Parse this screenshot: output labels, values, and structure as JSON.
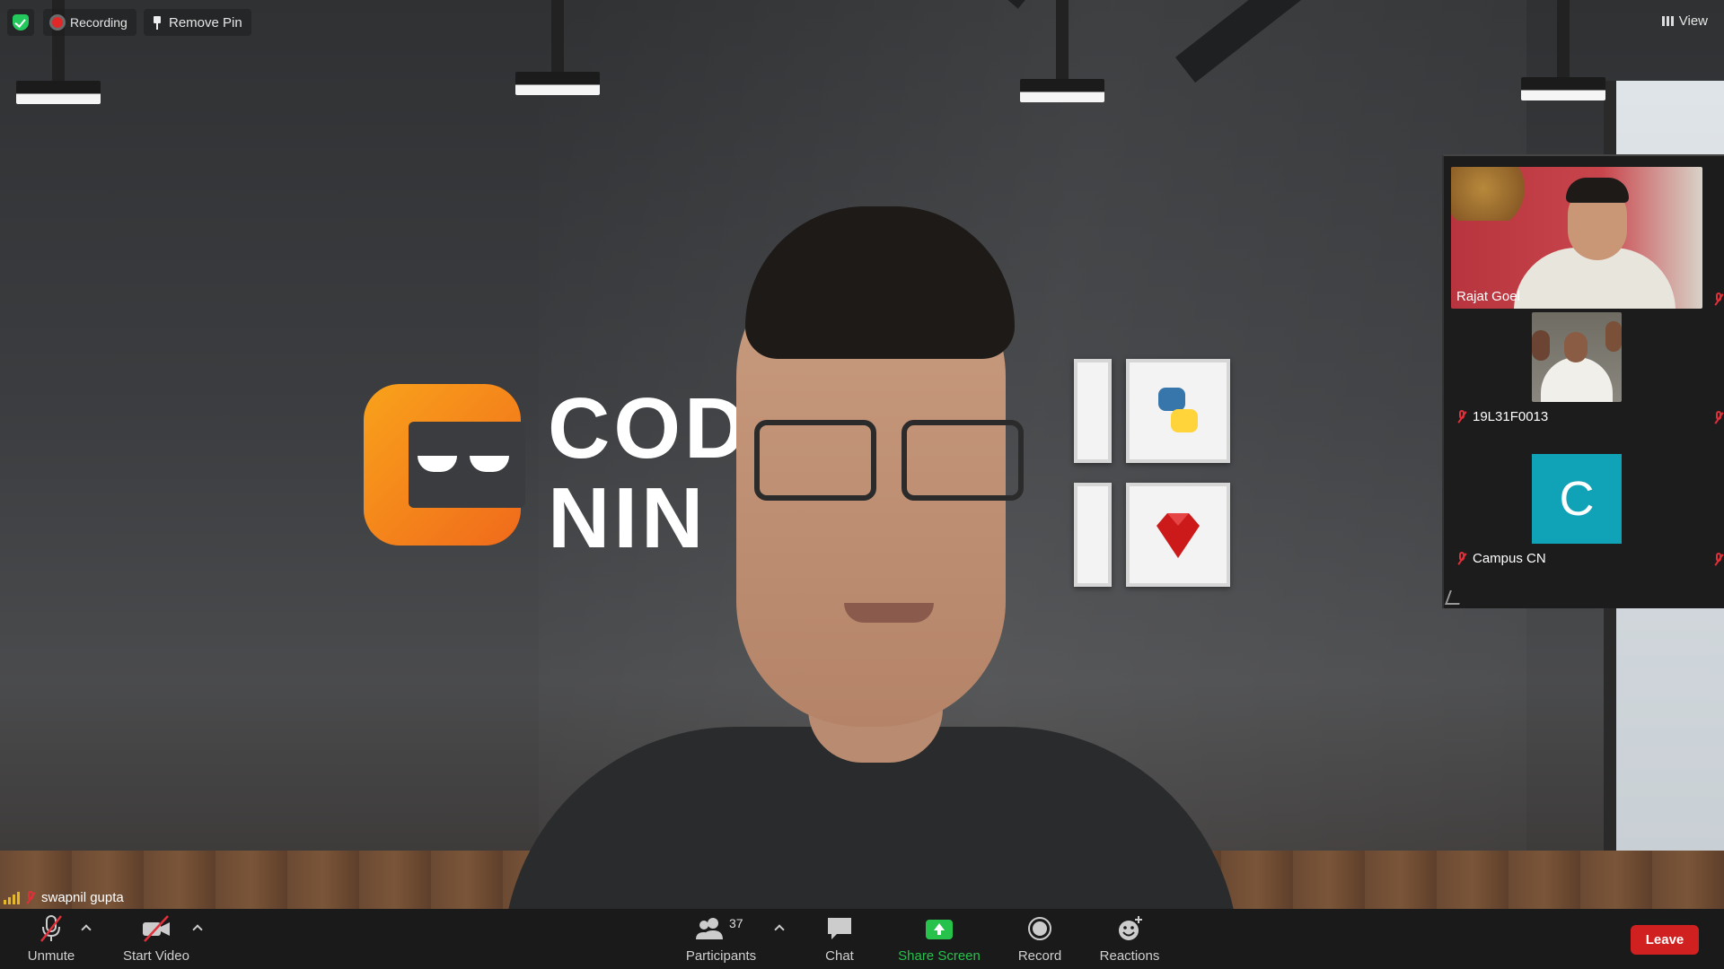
{
  "top_bar": {
    "recording_label": "Recording",
    "remove_pin_label": "Remove Pin",
    "view_label": "View"
  },
  "main_video": {
    "logo_text_line1": "COD",
    "logo_text_line2": "NIN",
    "participant_name": "swapnil gupta"
  },
  "side_panel": {
    "tiles": [
      {
        "name": "Rajat Goel",
        "muted": true
      },
      {
        "name": "19L31F0013",
        "muted": true
      },
      {
        "name": "Campus CN",
        "avatar_letter": "C",
        "muted": true
      }
    ]
  },
  "toolbar": {
    "unmute_label": "Unmute",
    "start_video_label": "Start Video",
    "participants_label": "Participants",
    "participants_count": "37",
    "chat_label": "Chat",
    "share_screen_label": "Share Screen",
    "record_label": "Record",
    "reactions_label": "Reactions",
    "leave_label": "Leave"
  },
  "colors": {
    "share_accent": "#27c24c",
    "leave_red": "#d0201f",
    "mute_red": "#e0303a",
    "avatar_teal": "#10a3b8",
    "encryption_green": "#23c95d"
  }
}
